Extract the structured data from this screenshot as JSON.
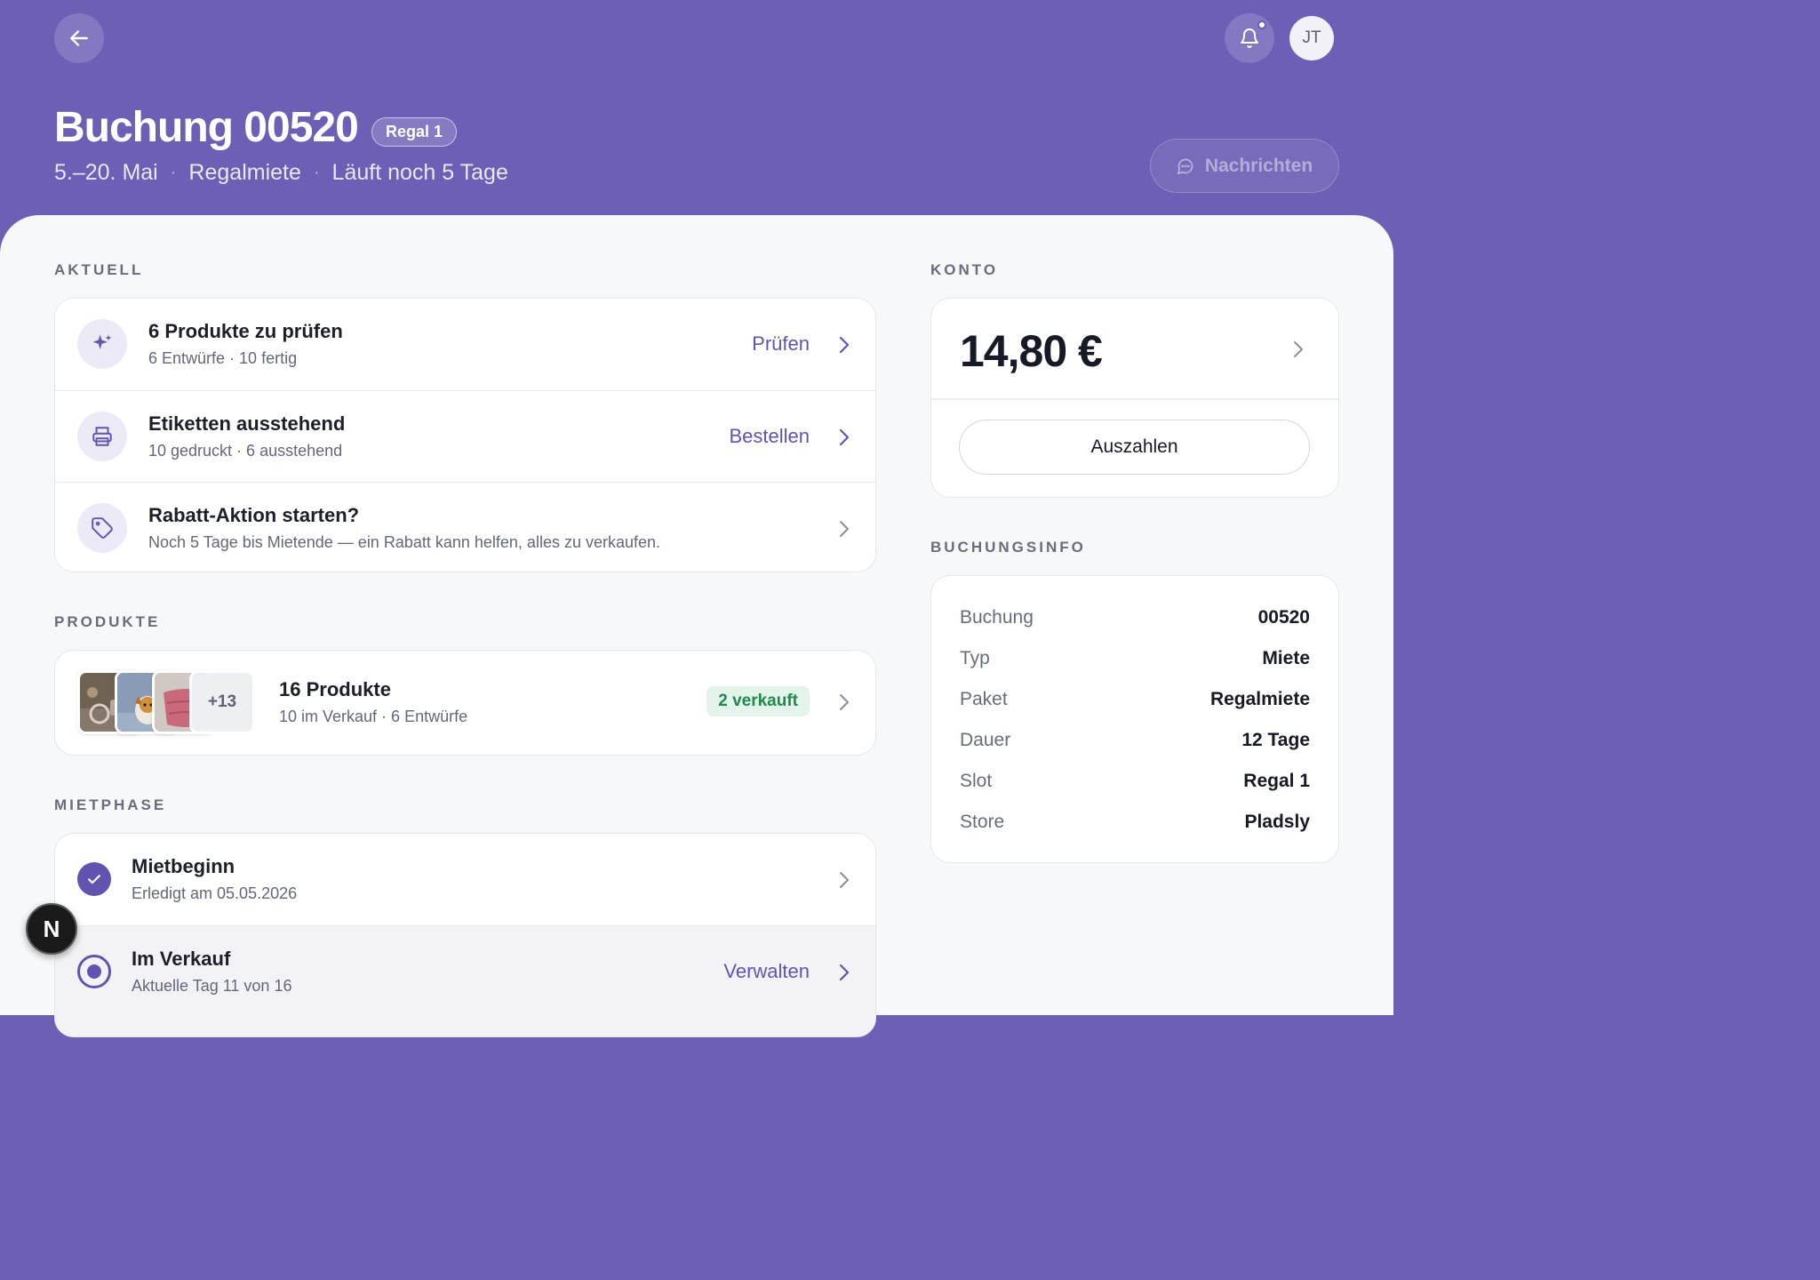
{
  "header": {
    "title": "Buchung 00520",
    "badge": "Regal 1",
    "subtitle": {
      "dates": "5.–20. Mai",
      "type": "Regalmiete",
      "remaining": "Läuft noch 5 Tage",
      "separator": "·"
    },
    "avatar_initials": "JT",
    "messages_label": "Nachrichten",
    "icons": [
      "arrow-left-icon",
      "bell-icon",
      "chat-icon"
    ]
  },
  "aktuell": {
    "label": "AKTUELL",
    "items": [
      {
        "title": "6 Produkte zu prüfen",
        "sub": "6 Entwürfe · 10 fertig",
        "action": "Prüfen",
        "icon": "sparkles-icon"
      },
      {
        "title": "Etiketten ausstehend",
        "sub": "10 gedruckt · 6 ausstehend",
        "action": "Bestellen",
        "icon": "printer-icon"
      },
      {
        "title": "Rabatt-Aktion starten?",
        "sub": "Noch 5 Tage bis Mietende — ein Rabatt kann helfen, alles zu verkaufen.",
        "action": "",
        "icon": "tag-icon"
      }
    ]
  },
  "produkte": {
    "label": "PRODUKTE",
    "more_count": "+13",
    "title": "16 Produkte",
    "sub": "10 im Verkauf · 6 Entwürfe",
    "badge": "2 verkauft"
  },
  "mietphase": {
    "label": "MIETPHASE",
    "items": [
      {
        "title": "Mietbeginn",
        "sub": "Erledigt am 05.05.2026",
        "action": "",
        "state": "done"
      },
      {
        "title": "Im Verkauf",
        "sub": "Aktuelle Tag 11 von 16",
        "action": "Verwalten",
        "state": "current"
      }
    ]
  },
  "konto": {
    "label": "KONTO",
    "amount": "14,80 €",
    "payout_label": "Auszahlen"
  },
  "buchungsinfo": {
    "label": "BUCHUNGSINFO",
    "rows": [
      {
        "key": "Buchung",
        "value": "00520"
      },
      {
        "key": "Typ",
        "value": "Miete"
      },
      {
        "key": "Paket",
        "value": "Regalmiete"
      },
      {
        "key": "Dauer",
        "value": "12 Tage"
      },
      {
        "key": "Slot",
        "value": "Regal 1"
      },
      {
        "key": "Store",
        "value": "Pladsly"
      }
    ]
  },
  "fab_label": "N",
  "colors": {
    "header_bg": "#6c5fb5",
    "accent": "#6253b0",
    "sold_bg": "#e3f4ea",
    "sold_text": "#1f8a4c"
  }
}
